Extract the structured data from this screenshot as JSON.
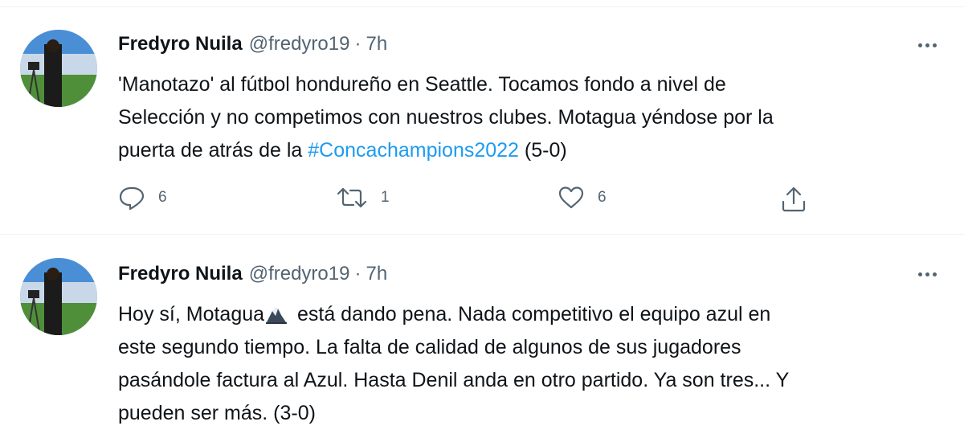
{
  "tweets": [
    {
      "author": "Fredyro Nuila",
      "handle": "@fredyro19",
      "separator": "·",
      "time": "7h",
      "text_lines": [
        "'Manotazo' al fútbol hondureño en Seattle. Tocamos fondo a nivel de",
        "Selección y no competimos con nuestros clubes. Motagua yéndose por la"
      ],
      "last_line_prefix": "puerta de atrás de la ",
      "hashtag": "#Concachampions2022",
      "last_line_suffix": " (5-0)",
      "replies": "6",
      "retweets": "1",
      "likes": "6"
    },
    {
      "author": "Fredyro Nuila",
      "handle": "@fredyro19",
      "separator": "·",
      "time": "7h",
      "first_line_before_emoji": "Hoy sí, Motagua",
      "first_line_after_emoji": " está dando pena. Nada competitivo el equipo azul en",
      "text_lines": [
        "este segundo tiempo. La falta de calidad de algunos de sus jugadores",
        "pasándole factura al Azul. Hasta Denil anda en otro partido. Ya son tres... Y",
        "pueden ser más. (3-0)"
      ]
    }
  ],
  "icons": {
    "more": "more-horizontal-icon",
    "reply": "reply-icon",
    "retweet": "retweet-icon",
    "like": "heart-icon",
    "share": "share-icon",
    "emoji": "eagle-emoji-icon"
  },
  "colors": {
    "text": "#0f1419",
    "muted": "#536471",
    "link": "#1d9bf0",
    "divider": "#eff3f4"
  }
}
